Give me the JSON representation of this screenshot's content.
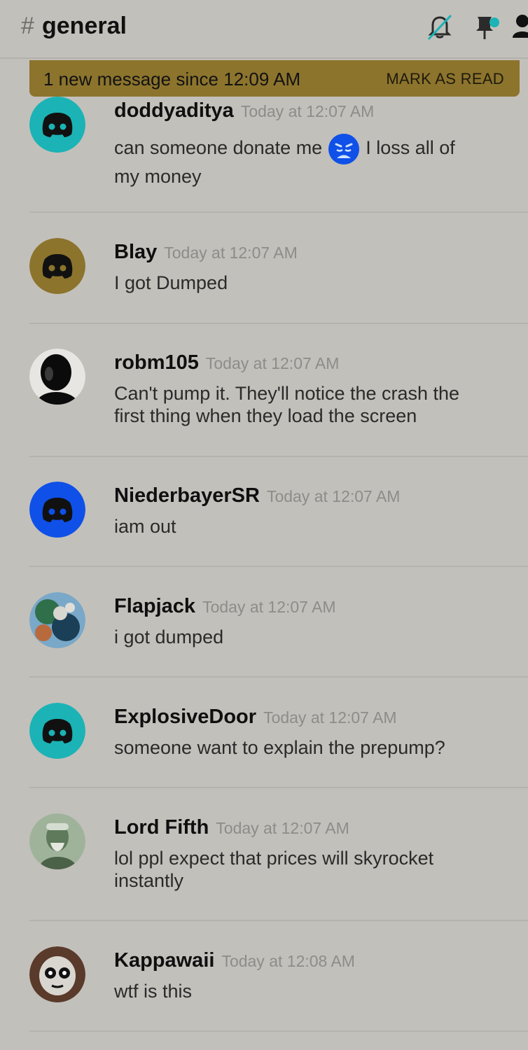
{
  "header": {
    "hash": "#",
    "channel": "general",
    "icons": [
      "bell-muted-icon",
      "pin-icon",
      "members-icon"
    ]
  },
  "banner": {
    "text": "1 new message since 12:09 AM",
    "action": "MARK AS READ"
  },
  "messages": [
    {
      "user": "doddyaditya",
      "time": "Today at 12:07 AM",
      "text_a": "can someone donate me",
      "emoji": "weary-face-emoji",
      "text_b": "I loss all of",
      "text_c": "my money",
      "avatar": "discord-teal"
    },
    {
      "user": "Blay",
      "time": "Today at 12:07 AM",
      "text": "I got Dumped",
      "avatar": "discord-gold"
    },
    {
      "user": "robm105",
      "time": "Today at 12:07 AM",
      "text_line1": "Can't pump it. They'll notice the crash the",
      "text_line2": "first thing when they load the screen",
      "avatar": "photo-silhouette"
    },
    {
      "user": "NiederbayerSR",
      "time": "Today at 12:07 AM",
      "text": "iam out",
      "avatar": "discord-blue"
    },
    {
      "user": "Flapjack",
      "time": "Today at 12:07 AM",
      "text": "i got dumped",
      "avatar": "photo-abstract"
    },
    {
      "user": "ExplosiveDoor",
      "time": "Today at 12:07 AM",
      "text": "someone want to explain the prepump?",
      "avatar": "discord-teal"
    },
    {
      "user": "Lord Fifth",
      "time": "Today at 12:07 AM",
      "text_line1": "lol ppl expect that prices will skyrocket",
      "text_line2": "instantly",
      "avatar": "photo-green"
    },
    {
      "user": "Kappawaii",
      "time": "Today at 12:08 AM",
      "text": "wtf is this",
      "avatar": "photo-face"
    }
  ],
  "colors": {
    "background": "#c2c0bb",
    "banner": "#8c742d",
    "teal": "#1bb3b5",
    "gold": "#8c742d",
    "blue": "#0f50e8"
  }
}
